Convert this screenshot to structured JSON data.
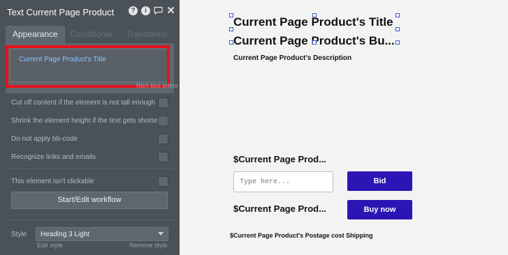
{
  "panel": {
    "title": "Text Current Page Product",
    "icons": [
      "help-icon",
      "info-icon",
      "comment-icon",
      "close-icon"
    ],
    "tabs": [
      {
        "label": "Appearance",
        "active": true
      },
      {
        "label": "Conditional",
        "active": false
      },
      {
        "label": "Transitions",
        "active": false
      }
    ],
    "expression": "Current Page Product's Title",
    "expression_tail": "Rich text editor",
    "options": [
      "Cut off content if the element is not tall enough",
      "Shrink the element height if the text gets shorter",
      "Do not apply bb-code",
      "Recognize links and emails",
      "This element isn't clickable"
    ],
    "workflow_button": "Start/Edit workflow",
    "style_label": "Style",
    "style_value": "Heading 3 Light",
    "edit_style": "Edit style",
    "remove_style": "Remove style",
    "highlight_color": "#e8101a"
  },
  "canvas": {
    "title": "Current Page Product's Title",
    "subtitle": "Current Page Product's Bu...",
    "description": "Current Page Product's Description",
    "price_1": "$Current Page Prod...",
    "bid_placeholder": "Type here...",
    "bid_button": "Bid",
    "price_2": "$Current Page Prod...",
    "buy_button": "Buy now",
    "postage": "$Current Page Product's Postage cost Shipping",
    "button_color": "#2b15b4"
  }
}
